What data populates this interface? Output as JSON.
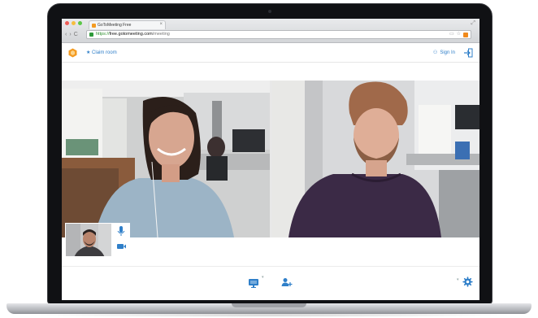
{
  "browser": {
    "tab_title": "GoToMeeting Free",
    "tab_close": "×",
    "url_scheme": "https://",
    "url_host": "free.gotomeeting.com",
    "url_path": "/meeting",
    "nav_back": "‹",
    "nav_forward": "›",
    "nav_reload": "C"
  },
  "header": {
    "claim_room": "★ Claim room",
    "sign_in": "Sign In"
  },
  "colors": {
    "accent": "#2f7fc9",
    "brand_orange": "#f49b21"
  },
  "participants": [
    {
      "label": "participant-woman"
    },
    {
      "label": "participant-man"
    }
  ],
  "toolbar": {
    "screen_share_icon": "monitor-icon",
    "invite_icon": "add-user-icon",
    "settings_icon": "gear-icon"
  }
}
